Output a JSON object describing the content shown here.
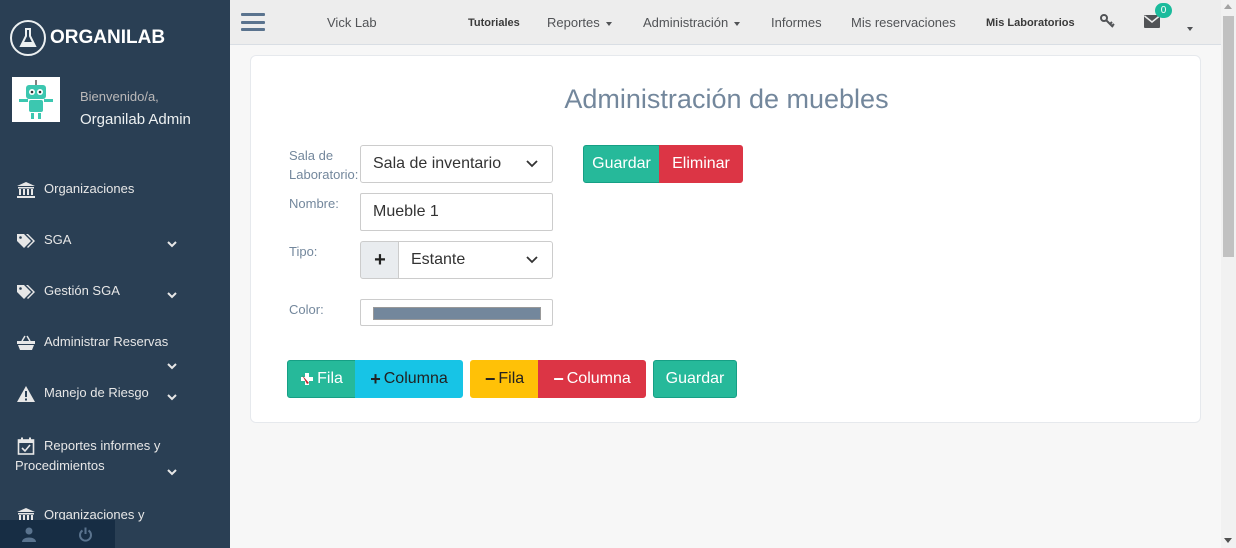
{
  "sidebar": {
    "brand": "ORGANILAB",
    "welcome": "Bienvenido/a,",
    "username": "Organilab Admin",
    "items": [
      {
        "label": "Organizaciones",
        "icon": "institution-icon",
        "has_chevron": false
      },
      {
        "label": "SGA",
        "icon": "tags-icon",
        "has_chevron": true
      },
      {
        "label": "Gestión SGA",
        "icon": "tags-icon",
        "has_chevron": true
      },
      {
        "label": "Administrar Reservas",
        "icon": "basket-icon",
        "has_chevron": true
      },
      {
        "label": "Manejo de Riesgo",
        "icon": "warning-icon",
        "has_chevron": true
      },
      {
        "label": "Reportes informes y",
        "label2": "Procedimientos",
        "icon": "calendar-check-icon",
        "has_chevron": true
      },
      {
        "label": "Organizaciones y",
        "icon": "institution-icon",
        "has_chevron": false
      }
    ],
    "footer": [
      "user-icon",
      "power-icon"
    ]
  },
  "topnav": {
    "lab_name": "Vick Lab",
    "links": [
      {
        "label": "Tutoriales",
        "dropdown": false
      },
      {
        "label": "Reportes",
        "dropdown": true
      },
      {
        "label": "Administración",
        "dropdown": true
      },
      {
        "label": "Informes",
        "dropdown": false
      },
      {
        "label": "Mis reservaciones",
        "dropdown": false
      },
      {
        "label": "Mis Laboratorios",
        "dropdown": false
      }
    ],
    "messages_count": "0"
  },
  "page": {
    "title": "Administración de muebles",
    "form": {
      "room_label_1": "Sala de",
      "room_label_2": "Laboratorio:",
      "room_value": "Sala de inventario",
      "name_label": "Nombre:",
      "name_value": "Mueble 1",
      "type_label": "Tipo:",
      "type_add": "+",
      "type_value": "Estante",
      "color_label": "Color:",
      "color_value": "#73879c"
    },
    "actions": {
      "save": "Guardar",
      "delete": "Eliminar"
    },
    "grid_buttons": {
      "add_row": "Fila",
      "add_column": "Columna",
      "remove_row": "Fila",
      "remove_column": "Columna",
      "save": "Guardar"
    }
  },
  "colors": {
    "sidebar_bg": "#2a3f54",
    "green": "#26B99A",
    "red": "#dc3545",
    "cyan": "#17c4e6",
    "yellow": "#ffc107",
    "title": "#73879C"
  }
}
